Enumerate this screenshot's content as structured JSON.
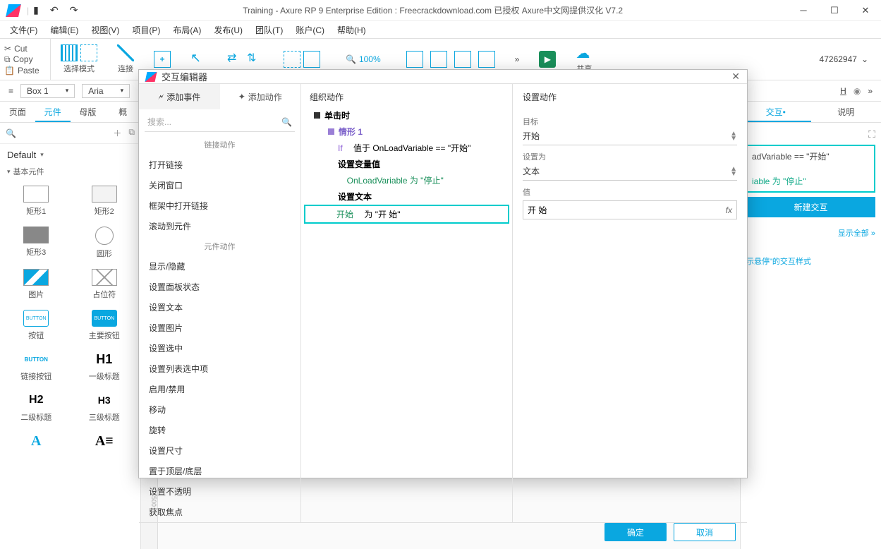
{
  "titlebar": {
    "title": "Training - Axure RP 9 Enterprise Edition : Freecrackdownload.com 已授权    Axure中文网提供汉化 V7.2",
    "qa_save": "▮",
    "qa_undo": "↶",
    "qa_redo": "↷"
  },
  "menu": {
    "file": "文件(F)",
    "edit": "编辑(E)",
    "view": "视图(V)",
    "project": "项目(P)",
    "layout": "布局(A)",
    "publish": "发布(U)",
    "team": "团队(T)",
    "account": "账户(C)",
    "help": "帮助(H)"
  },
  "toolbar": {
    "cut": "Cut",
    "copy": "Copy",
    "paste": "Paste",
    "select_mode": "选择模式",
    "connect": "连接",
    "zoom": "100%",
    "share": "共享",
    "id": "47262947"
  },
  "subbar": {
    "shape": "Box 1",
    "font": "Aria",
    "right": "H",
    "more": "»"
  },
  "left": {
    "tabs": {
      "pages": "页面",
      "widgets": "元件",
      "masters": "母版",
      "outline": "概"
    },
    "lib": "Default",
    "cat": "基本元件",
    "items": {
      "rect1": "矩形1",
      "rect2": "矩形2",
      "rect3": "矩形3",
      "circle": "圆形",
      "image": "图片",
      "placeholder": "占位符",
      "button": "按钮",
      "primary": "主要按钮",
      "link": "链接按钮",
      "h1": "一级标题",
      "h2": "二级标题",
      "h3": "三级标题"
    },
    "badges": {
      "button": "BUTTON",
      "primary": "BUTTON",
      "link": "BUTTON",
      "h1": "H1",
      "h2": "H2",
      "h3": "H3"
    }
  },
  "right": {
    "tabs": {
      "interact": "交互•",
      "notes": "说明"
    },
    "cond": "adVariable == \"开始\"",
    "set": "iable 为 \"停止\"",
    "newbtn": "新建交互",
    "showall": "显示全部 »",
    "hover": "示悬停\"的交互样式"
  },
  "dialog": {
    "title": "交互编辑器",
    "tabs": {
      "events": "添加事件",
      "actions": "添加动作"
    },
    "search": "搜索...",
    "groups": {
      "link": "链接动作",
      "widget": "元件动作"
    },
    "linkActions": {
      "open": "打开链接",
      "close": "关闭窗口",
      "frame": "框架中打开链接",
      "scroll": "滚动到元件"
    },
    "widgetActions": {
      "showhide": "显示/隐藏",
      "panel": "设置面板状态",
      "text": "设置文本",
      "image": "设置图片",
      "checked": "设置选中",
      "list": "设置列表选中项",
      "enable": "启用/禁用",
      "move": "移动",
      "rotate": "旋转",
      "size": "设置尺寸",
      "layer": "置于顶层/底层",
      "opacity": "设置不透明",
      "focus": "获取焦点"
    },
    "col2": {
      "header": "组织动作",
      "click": "单击时",
      "case": "情形 1",
      "if_lbl": "If",
      "if_cond": "值于 OnLoadVariable == \"开始\"",
      "setvar": "设置变量值",
      "setvar_val": "OnLoadVariable 为 \"停止\"",
      "settext": "设置文本",
      "settext_target": "开始",
      "settext_to": "为 \"开 始\""
    },
    "col3": {
      "header": "设置动作",
      "target_lbl": "目标",
      "target": "开始",
      "as_lbl": "设置为",
      "as": "文本",
      "value_lbl": "值",
      "value": "开 始",
      "fx": "fx"
    },
    "ok": "确定",
    "cancel": "取消"
  }
}
